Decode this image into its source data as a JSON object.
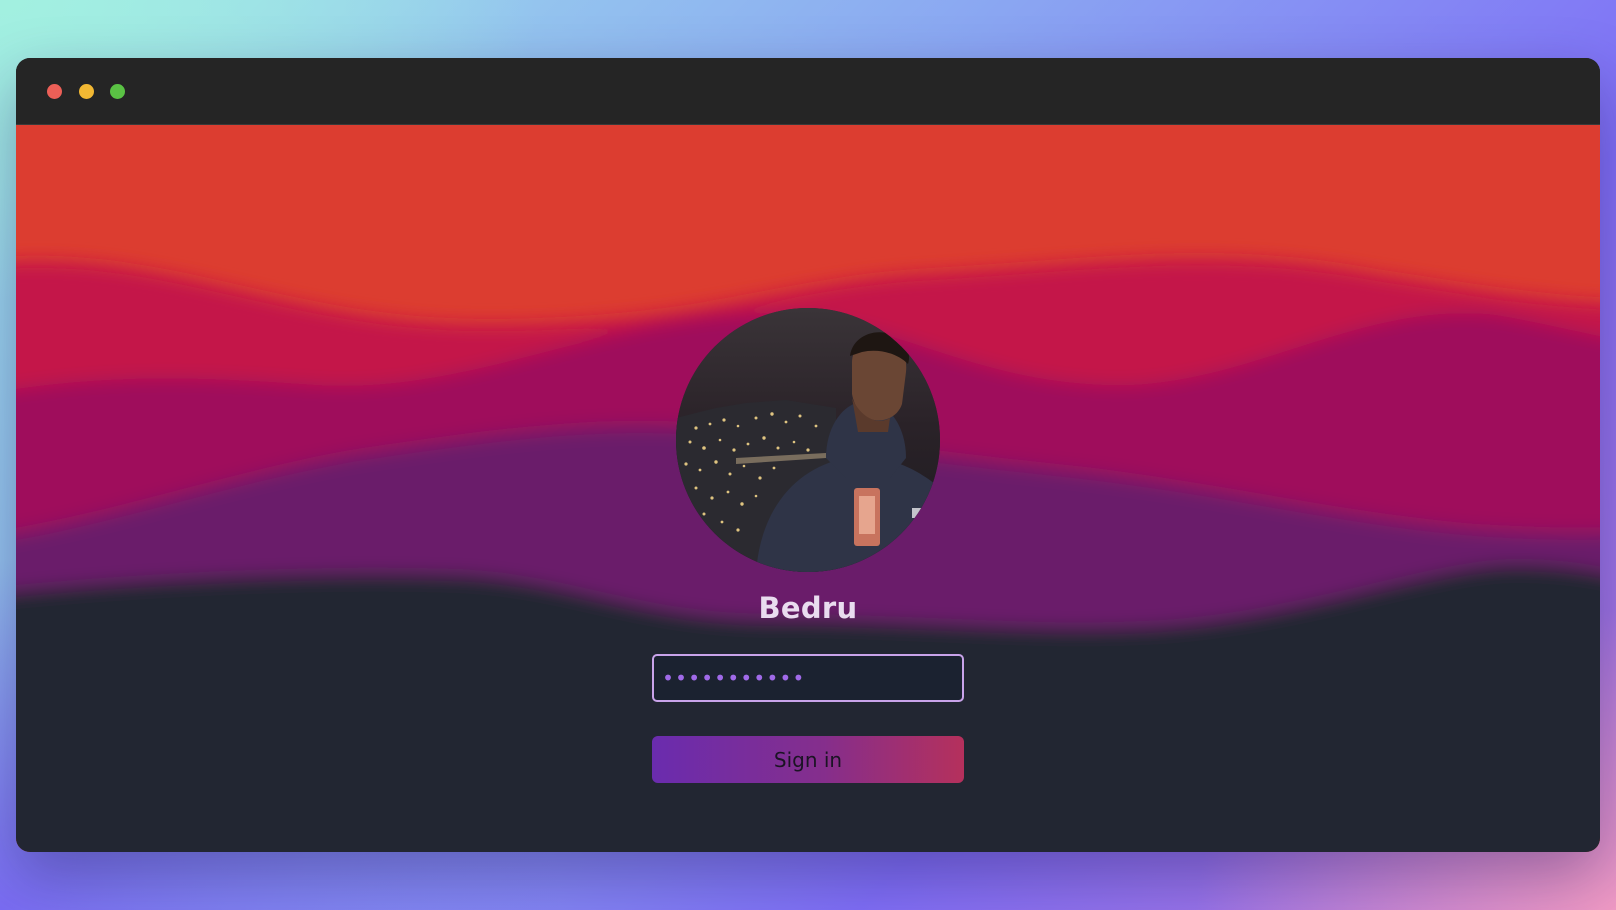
{
  "window": {
    "controls": [
      {
        "name": "close",
        "color": "#ec5f57"
      },
      {
        "name": "minimize",
        "color": "#f2b833"
      },
      {
        "name": "maximize",
        "color": "#5ac244"
      }
    ]
  },
  "wallpaper": {
    "colors": [
      "#dc3d30",
      "#c4174a",
      "#9f0b5c",
      "#6b1a6b",
      "#202631"
    ]
  },
  "login": {
    "avatar_icon": "user-photo",
    "username": "Bedru",
    "password_value": "•••••••••••",
    "signin_label": "Sign in"
  },
  "colors": {
    "accent": "#a06ae8",
    "signin_gradient": [
      "#6a2cae",
      "#b5305c"
    ]
  }
}
